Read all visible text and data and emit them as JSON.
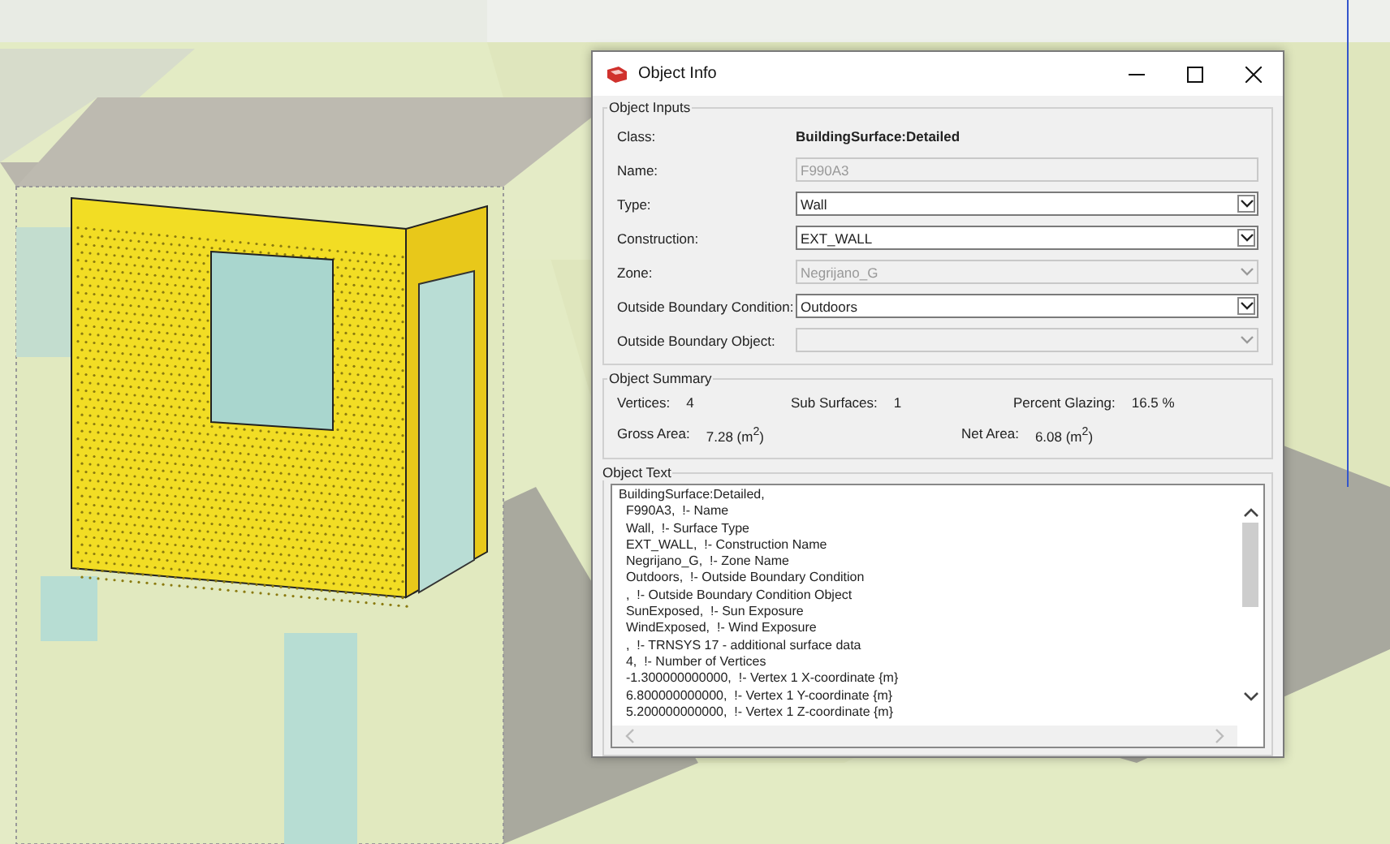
{
  "window": {
    "title": "Object Info"
  },
  "object_inputs": {
    "title": "Object Inputs",
    "class_label": "Class:",
    "class_value": "BuildingSurface:Detailed",
    "fields": [
      {
        "label": "Name:",
        "kind": "text",
        "value": "F990A3",
        "disabled": true
      },
      {
        "label": "Type:",
        "kind": "dropdown",
        "value": "Wall",
        "disabled": false
      },
      {
        "label": "Construction:",
        "kind": "dropdown",
        "value": "EXT_WALL",
        "disabled": false
      },
      {
        "label": "Zone:",
        "kind": "dropdown",
        "value": "Negrijano_G",
        "disabled": true
      },
      {
        "label": "Outside Boundary Condition:",
        "kind": "dropdown",
        "value": "Outdoors",
        "disabled": false
      },
      {
        "label": "Outside Boundary Object:",
        "kind": "dropdown",
        "disabled": true
      }
    ]
  },
  "object_summary": {
    "title": "Object Summary",
    "rows": [
      [
        {
          "label": "Vertices:",
          "value": "4"
        },
        {
          "label": "Sub Surfaces:",
          "value": "1"
        },
        {
          "label": "Percent Glazing:",
          "value": "16.5 %"
        }
      ],
      [
        {
          "label": "Gross Area:",
          "value": "7.28 (m$^{2}$)"
        },
        {
          "label": "Net Area:",
          "value": "6.08 (m$^{2}$)"
        }
      ]
    ]
  },
  "object_text": {
    "title": "Object Text",
    "lines": [
      "BuildingSurface:Detailed,",
      "  F990A3,  !- Name",
      "  Wall,  !- Surface Type",
      "  EXT_WALL,  !- Construction Name",
      "  Negrijano_G,  !- Zone Name",
      "  Outdoors,  !- Outside Boundary Condition",
      "  ,  !- Outside Boundary Condition Object",
      "  SunExposed,  !- Sun Exposure",
      "  WindExposed,  !- Wind Exposure",
      "  ,  !- TRNSYS 17 - additional surface data",
      "  4,  !- Number of Vertices",
      "  -1.300000000000,  !- Vertex 1 X-coordinate {m}",
      "  6.800000000000,  !- Vertex 1 Y-coordinate {m}",
      "  5.200000000000,  !- Vertex 1 Z-coordinate {m}"
    ]
  }
}
